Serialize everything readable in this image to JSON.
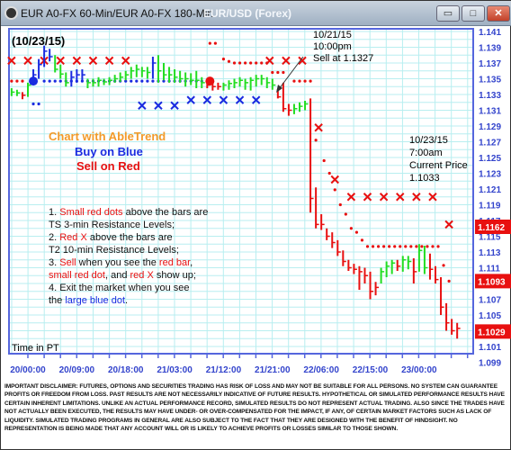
{
  "window": {
    "title": "EUR A0-FX 60-Min/EUR A0-FX 180-Min",
    "subtitle": "EUR/USD (Forex)",
    "buttons": {
      "minimize": "▭",
      "maximize": "□",
      "close": "✕"
    }
  },
  "colors": {
    "up": "#22dd22",
    "down": "#e81010",
    "buy": "#1a2be0",
    "grid": "#b8eef0",
    "axis": "#5566dd",
    "legend_title": "#f39a2a"
  },
  "annotations": {
    "date": "(10/23/15)",
    "sell_note": [
      "10/21/15",
      "10:00pm",
      "Sell at 1.1327"
    ],
    "current_note": [
      "10/23/15",
      "7:00am",
      "Current Price",
      "1.1033"
    ],
    "legend_title": "Chart with AbleTrend",
    "legend_buy": "Buy on Blue",
    "legend_sell": "Sell on Red",
    "time_zone": "Time in PT",
    "instructions": {
      "l1a": "1. ",
      "l1b": "Small red dots",
      "l1c": " above the bars are",
      "l2": "TS 3-min Resistance Levels;",
      "l3a": "2. ",
      "l3b": "Red X",
      "l3c": " above the bars are",
      "l4": "T2 10-min Resistance Levels;",
      "l5a": "3. ",
      "l5b": "Sell",
      "l5c": " when you see the ",
      "l5d": "red bar",
      ",": ",",
      "l6a": "small red dot",
      "l6b": ", and ",
      "l6c": "red X",
      "l6d": " show up;",
      "l7": "4. Exit the market when you see",
      "l8a": "the ",
      "l8b": "large blue dot",
      "l8c": "."
    }
  },
  "disclaimer": "IMPORTANT DISCLAIMER:  FUTURES, OPTIONS AND SECURITIES TRADING HAS RISK OF LOSS AND MAY NOT BE SUITABLE FOR ALL PERSONS. NO SYSTEM CAN GUARANTEE PROFITS OR FREEDOM FROM LOSS. PAST RESULTS ARE NOT NECESSARILY INDICATIVE OF FUTURE RESULTS. HYPOTHETICAL OR SIMULATED PERFORMANCE RESULTS HAVE CERTAIN INHERENT LIMITATIONS. UNLIKE AN ACTUAL PERFORMANCE RECORD, SIMULATED RESULTS DO NOT REPRESENT ACTUAL TRADING. ALSO SINCE THE TRADES HAVE NOT ACTUALLY BEEN EXECUTED, THE RESULTS MAY HAVE UNDER- OR OVER-COMPENSATED FOR THE IMPACT, IF ANY, OF CERTAIN MARKET FACTORS SUCH AS LACK OF LIQUIDITY. SIMULATED TRADING PROGRAMS IN GENERAL ARE ALSO SUBJECT TO THE FACT THAT THEY ARE DESIGNED WITH THE BENEFIT OF HINDSIGHT. NO REPRESENTATION IS BEING MADE THAT ANY ACCOUNT WILL OR IS LIKELY TO ACHIEVE PROFITS OR LOSSES SIMILAR TO THOSE SHOWN.",
  "chart_data": {
    "type": "ohlc-bar",
    "ylim": [
      1.1,
      1.141
    ],
    "y_ticks": [
      "1.141",
      "1.139",
      "1.137",
      "1.135",
      "1.133",
      "1.131",
      "1.129",
      "1.127",
      "1.125",
      "1.123",
      "1.121",
      "1.119",
      "1.117",
      "1.115",
      "1.113",
      "1.111",
      "1.109",
      "1.107",
      "1.105",
      "1.103",
      "1.101",
      "1.099"
    ],
    "x_ticks": [
      "20/00:00",
      "20/09:00",
      "20/18:00",
      "21/03:00",
      "21/12:00",
      "21/21:00",
      "22/06:00",
      "22/15:00",
      "23/00:00"
    ],
    "grid": true,
    "price_labels": [
      {
        "value": "1.1162"
      },
      {
        "value": "1.1093"
      },
      {
        "value": "1.1029"
      }
    ],
    "bars": [
      [
        "19/21:00",
        1.1338,
        1.1328,
        1.1333,
        "green"
      ],
      [
        "19/22:00",
        1.1336,
        1.1328,
        1.1332,
        "green"
      ],
      [
        "19/23:00",
        1.1333,
        1.1324,
        1.1329,
        "red"
      ],
      [
        "20/00:00",
        1.1345,
        1.1327,
        1.1342,
        "green"
      ],
      [
        "20/01:00",
        1.1362,
        1.1342,
        1.1355,
        "blue"
      ],
      [
        "20/02:00",
        1.1375,
        1.135,
        1.1368,
        "blue"
      ],
      [
        "20/03:00",
        1.1392,
        1.1365,
        1.1385,
        "blue"
      ],
      [
        "20/04:00",
        1.1388,
        1.1372,
        1.1378,
        "blue"
      ],
      [
        "20/05:00",
        1.138,
        1.1358,
        1.1362,
        "green"
      ],
      [
        "20/06:00",
        1.1368,
        1.135,
        1.1356,
        "green"
      ],
      [
        "20/07:00",
        1.1358,
        1.134,
        1.1345,
        "green"
      ],
      [
        "20/08:00",
        1.136,
        1.134,
        1.1352,
        "blue"
      ],
      [
        "20/09:00",
        1.1362,
        1.1345,
        1.1355,
        "blue"
      ],
      [
        "20/10:00",
        1.1362,
        1.1348,
        1.1355,
        "blue"
      ],
      [
        "20/11:00",
        1.135,
        1.1338,
        1.1345,
        "green"
      ],
      [
        "20/12:00",
        1.135,
        1.134,
        1.1345,
        "green"
      ],
      [
        "20/13:00",
        1.1352,
        1.134,
        1.1348,
        "green"
      ],
      [
        "20/14:00",
        1.135,
        1.1342,
        1.1346,
        "green"
      ],
      [
        "20/15:00",
        1.1352,
        1.1342,
        1.1348,
        "green"
      ],
      [
        "20/16:00",
        1.1355,
        1.1345,
        1.135,
        "green"
      ],
      [
        "20/17:00",
        1.1358,
        1.1346,
        1.1352,
        "green"
      ],
      [
        "20/18:00",
        1.136,
        1.1348,
        1.1355,
        "green"
      ],
      [
        "20/19:00",
        1.1365,
        1.135,
        1.136,
        "green"
      ],
      [
        "20/20:00",
        1.1368,
        1.1352,
        1.1362,
        "green"
      ],
      [
        "20/21:00",
        1.1365,
        1.1352,
        1.136,
        "green"
      ],
      [
        "20/22:00",
        1.1365,
        1.135,
        1.1358,
        "green"
      ],
      [
        "20/23:00",
        1.1378,
        1.135,
        1.137,
        "blue"
      ],
      [
        "21/00:00",
        1.138,
        1.1345,
        1.136,
        "green"
      ],
      [
        "21/01:00",
        1.137,
        1.1348,
        1.1355,
        "green"
      ],
      [
        "21/02:00",
        1.1365,
        1.1345,
        1.1355,
        "green"
      ],
      [
        "21/03:00",
        1.1362,
        1.1345,
        1.1352,
        "green"
      ],
      [
        "21/04:00",
        1.136,
        1.1345,
        1.135,
        "green"
      ],
      [
        "21/05:00",
        1.1358,
        1.134,
        1.135,
        "green"
      ],
      [
        "21/06:00",
        1.1357,
        1.1342,
        1.1348,
        "green"
      ],
      [
        "21/07:00",
        1.136,
        1.1338,
        1.1348,
        "green"
      ],
      [
        "21/08:00",
        1.1352,
        1.1338,
        1.1345,
        "green"
      ],
      [
        "21/09:00",
        1.135,
        1.1338,
        1.1342,
        "red"
      ],
      [
        "21/10:00",
        1.1345,
        1.1335,
        1.134,
        "red"
      ],
      [
        "21/11:00",
        1.1345,
        1.1336,
        1.134,
        "red"
      ],
      [
        "21/12:00",
        1.1345,
        1.1335,
        1.1342,
        "green"
      ],
      [
        "21/13:00",
        1.1348,
        1.1336,
        1.1344,
        "green"
      ],
      [
        "21/14:00",
        1.135,
        1.1338,
        1.1345,
        "green"
      ],
      [
        "21/15:00",
        1.1352,
        1.134,
        1.1348,
        "green"
      ],
      [
        "21/16:00",
        1.135,
        1.1336,
        1.1345,
        "green"
      ],
      [
        "21/17:00",
        1.1352,
        1.1335,
        1.1348,
        "green"
      ],
      [
        "21/18:00",
        1.1355,
        1.134,
        1.135,
        "green"
      ],
      [
        "21/19:00",
        1.1355,
        1.1342,
        1.135,
        "green"
      ],
      [
        "21/20:00",
        1.1352,
        1.1338,
        1.1345,
        "green"
      ],
      [
        "21/21:00",
        1.135,
        1.1336,
        1.1342,
        "green"
      ],
      [
        "21/22:00",
        1.1337,
        1.1325,
        1.1327,
        "red"
      ],
      [
        "21/23:00",
        1.1345,
        1.1308,
        1.1312,
        "red"
      ],
      [
        "22/00:00",
        1.1318,
        1.1303,
        1.131,
        "red"
      ],
      [
        "22/01:00",
        1.1318,
        1.1305,
        1.1312,
        "green"
      ],
      [
        "22/02:00",
        1.132,
        1.1308,
        1.1315,
        "green"
      ],
      [
        "22/03:00",
        1.1322,
        1.131,
        1.1318,
        "green"
      ],
      [
        "22/04:00",
        1.1325,
        1.118,
        1.1198,
        "red"
      ],
      [
        "22/05:00",
        1.1212,
        1.116,
        1.1165,
        "red"
      ],
      [
        "22/06:00",
        1.1178,
        1.1158,
        1.1165,
        "red"
      ],
      [
        "22/07:00",
        1.116,
        1.1145,
        1.115,
        "red"
      ],
      [
        "22/08:00",
        1.1155,
        1.1135,
        1.1142,
        "red"
      ],
      [
        "22/09:00",
        1.1145,
        1.1125,
        1.113,
        "red"
      ],
      [
        "22/10:00",
        1.1132,
        1.1112,
        1.1118,
        "red"
      ],
      [
        "22/11:00",
        1.112,
        1.1106,
        1.111,
        "red"
      ],
      [
        "22/12:00",
        1.1115,
        1.1102,
        1.1108,
        "red"
      ],
      [
        "22/13:00",
        1.1112,
        1.1082,
        1.1105,
        "red"
      ],
      [
        "22/14:00",
        1.111,
        1.109,
        1.11,
        "red"
      ],
      [
        "22/15:00",
        1.1105,
        1.107,
        1.108,
        "red"
      ],
      [
        "22/16:00",
        1.1092,
        1.1075,
        1.1085,
        "red"
      ],
      [
        "22/17:00",
        1.111,
        1.109,
        1.1105,
        "green"
      ],
      [
        "22/18:00",
        1.1118,
        1.1098,
        1.1112,
        "green"
      ],
      [
        "22/19:00",
        1.112,
        1.1102,
        1.1116,
        "green"
      ],
      [
        "22/20:00",
        1.112,
        1.1106,
        1.1112,
        "red"
      ],
      [
        "22/21:00",
        1.1125,
        1.1105,
        1.112,
        "green"
      ],
      [
        "22/22:00",
        1.1125,
        1.1108,
        1.1118,
        "green"
      ],
      [
        "22/23:00",
        1.1122,
        1.109,
        1.1105,
        "red"
      ],
      [
        "23/00:00",
        1.114,
        1.1105,
        1.1132,
        "green"
      ],
      [
        "23/01:00",
        1.1138,
        1.1102,
        1.111,
        "green"
      ],
      [
        "23/02:00",
        1.1128,
        1.1095,
        1.1108,
        "red"
      ],
      [
        "23/03:00",
        1.1112,
        1.109,
        1.1095,
        "red"
      ],
      [
        "23/04:00",
        1.1098,
        1.105,
        1.106,
        "red"
      ],
      [
        "23/05:00",
        1.1065,
        1.103,
        1.104,
        "red"
      ],
      [
        "23/06:00",
        1.1045,
        1.1025,
        1.103,
        "red"
      ],
      [
        "23/07:00",
        1.104,
        1.102,
        1.1033,
        "red"
      ]
    ],
    "red_dots": [
      [
        "19/21:00",
        1.1347
      ],
      [
        "19/22:00",
        1.1347
      ],
      [
        "19/23:00",
        1.1347
      ],
      [
        "21/09:30",
        1.1395
      ],
      [
        "21/10:30",
        1.1395
      ],
      [
        "21/12:00",
        1.1375
      ],
      [
        "21/13:00",
        1.1372
      ],
      [
        "21/14:00",
        1.137
      ],
      [
        "21/15:00",
        1.137
      ],
      [
        "21/16:00",
        1.137
      ],
      [
        "21/17:00",
        1.137
      ],
      [
        "21/18:00",
        1.137
      ],
      [
        "21/19:00",
        1.137
      ],
      [
        "21/20:00",
        1.137
      ],
      [
        "21/21:00",
        1.1358
      ],
      [
        "21/22:00",
        1.1358
      ],
      [
        "21/23:00",
        1.1358
      ],
      [
        "22/01:00",
        1.1347
      ],
      [
        "22/02:00",
        1.1347
      ],
      [
        "22/03:00",
        1.1347
      ],
      [
        "22/04:00",
        1.1347
      ],
      [
        "22/05:00",
        1.1272
      ],
      [
        "22/06:30",
        1.1246
      ],
      [
        "22/07:30",
        1.123
      ],
      [
        "22/08:30",
        1.1209
      ],
      [
        "22/09:30",
        1.119
      ],
      [
        "22/10:30",
        1.1178
      ],
      [
        "22/11:30",
        1.116
      ],
      [
        "22/12:30",
        1.1155
      ],
      [
        "22/13:30",
        1.1145
      ],
      [
        "22/14:30",
        1.1137
      ],
      [
        "22/15:30",
        1.1137
      ],
      [
        "22/16:30",
        1.1137
      ],
      [
        "22/17:30",
        1.1137
      ],
      [
        "22/18:30",
        1.1137
      ],
      [
        "22/19:30",
        1.1137
      ],
      [
        "22/20:30",
        1.1137
      ],
      [
        "22/21:30",
        1.1137
      ],
      [
        "22/22:30",
        1.1137
      ],
      [
        "22/23:30",
        1.1137
      ],
      [
        "23/00:30",
        1.1137
      ],
      [
        "23/01:30",
        1.1137
      ],
      [
        "23/02:30",
        1.1137
      ],
      [
        "23/03:30",
        1.1137
      ],
      [
        "23/04:30",
        1.1113
      ],
      [
        "23/05:30",
        1.1093
      ]
    ],
    "red_x": [
      [
        "19/21:00",
        1.1373
      ],
      [
        "20/00:00",
        1.1373
      ],
      [
        "20/03:00",
        1.1373
      ],
      [
        "20/06:00",
        1.1373
      ],
      [
        "20/09:00",
        1.1373
      ],
      [
        "20/12:00",
        1.1373
      ],
      [
        "20/15:00",
        1.1373
      ],
      [
        "20/18:00",
        1.1373
      ],
      [
        "21/20:30",
        1.1373
      ],
      [
        "21/23:30",
        1.1373
      ],
      [
        "22/02:30",
        1.1373
      ],
      [
        "22/05:30",
        1.1288
      ],
      [
        "22/08:30",
        1.1222
      ],
      [
        "22/11:30",
        1.12
      ],
      [
        "22/14:30",
        1.12
      ],
      [
        "22/17:30",
        1.12
      ],
      [
        "22/20:30",
        1.12
      ],
      [
        "22/23:30",
        1.12
      ],
      [
        "23/02:30",
        1.12
      ],
      [
        "23/05:30",
        1.1165
      ]
    ],
    "blue_dots": [
      [
        "20/01:00",
        1.1318
      ],
      [
        "20/02:00",
        1.1318
      ],
      [
        "20/03:00",
        1.1347
      ],
      [
        "20/04:00",
        1.1347
      ],
      [
        "20/05:00",
        1.1347
      ],
      [
        "20/06:00",
        1.1347
      ],
      [
        "20/07:00",
        1.1347
      ],
      [
        "20/08:00",
        1.1347
      ],
      [
        "20/09:00",
        1.1347
      ],
      [
        "20/10:00",
        1.1347
      ],
      [
        "20/11:00",
        1.1347
      ],
      [
        "20/12:00",
        1.1347
      ],
      [
        "20/13:00",
        1.1347
      ],
      [
        "20/14:00",
        1.1347
      ],
      [
        "20/15:00",
        1.1347
      ],
      [
        "20/16:00",
        1.1347
      ],
      [
        "20/17:00",
        1.1347
      ],
      [
        "20/18:00",
        1.1347
      ],
      [
        "20/19:00",
        1.1347
      ],
      [
        "20/20:00",
        1.1347
      ],
      [
        "20/21:00",
        1.1347
      ],
      [
        "20/22:00",
        1.1347
      ],
      [
        "20/23:00",
        1.1347
      ],
      [
        "21/00:00",
        1.1347
      ],
      [
        "21/01:00",
        1.1347
      ],
      [
        "21/02:00",
        1.1347
      ],
      [
        "21/03:00",
        1.1347
      ],
      [
        "21/04:00",
        1.1347
      ],
      [
        "21/05:00",
        1.1347
      ],
      [
        "21/06:00",
        1.1347
      ],
      [
        "21/07:00",
        1.1347
      ],
      [
        "21/08:00",
        1.1347
      ]
    ],
    "blue_x": [
      [
        "20/21:00",
        1.1316
      ],
      [
        "21/00:00",
        1.1316
      ],
      [
        "21/03:00",
        1.1316
      ],
      [
        "21/06:00",
        1.1323
      ],
      [
        "21/09:00",
        1.1323
      ],
      [
        "21/12:00",
        1.1323
      ],
      [
        "21/15:00",
        1.1323
      ],
      [
        "21/18:00",
        1.1323
      ]
    ],
    "large_blue_dot": [
      "20/01:00",
      1.1347
    ],
    "large_red_dot": [
      "21/09:30",
      1.1347
    ]
  }
}
